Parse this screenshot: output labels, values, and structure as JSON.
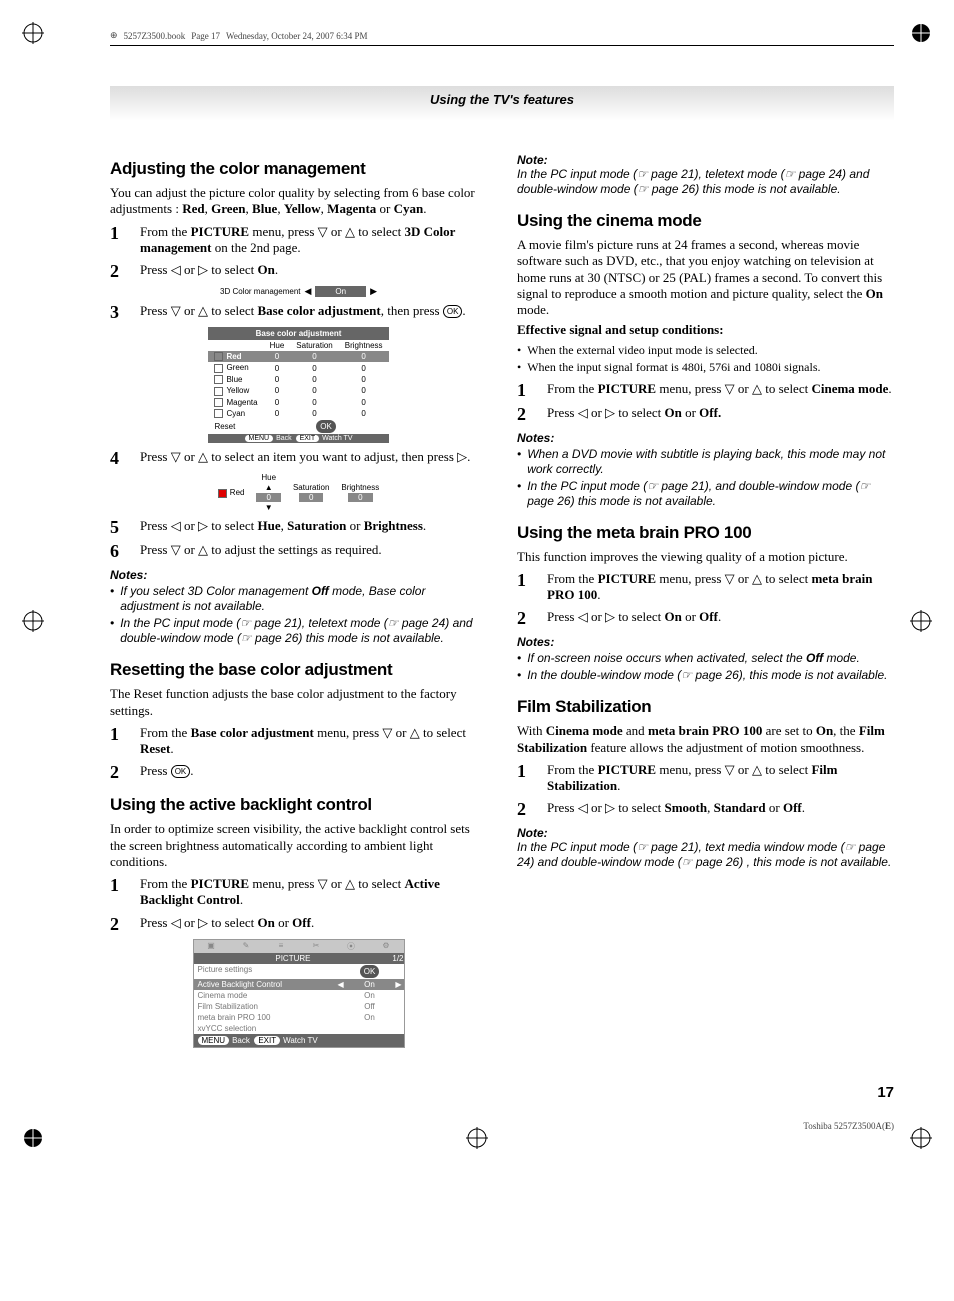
{
  "header": {
    "file": "5257Z3500.book",
    "page_info": "Page 17",
    "timestamp": "Wednesday, October 24, 2007  6:34 PM"
  },
  "banner": "Using the TV's features",
  "left": {
    "h1": "Adjusting the color management",
    "p1a": "You can adjust the picture color quality by selecting from 6 base color adjustments : ",
    "p1_red": "Red",
    "p1_c1": ", ",
    "p1_green": "Green",
    "p1_c2": ", ",
    "p1_blue": "Blue",
    "p1_c3": ", ",
    "p1_yellow": "Yellow",
    "p1_c4": ", ",
    "p1_magenta": "Magenta",
    "p1_or": " or ",
    "p1_cyan": "Cyan",
    "p1_end": ".",
    "s1a": "From the ",
    "s1b": "PICTURE",
    "s1c": " menu, press ▽ or △ to select ",
    "s1d": "3D Color management",
    "s1e": " on the 2nd page.",
    "s2a": "Press ◁ or ▷ to select ",
    "s2b": "On",
    "s2c": ".",
    "strip_label": "3D Color management",
    "strip_value": "On",
    "s3a": "Press ▽ or △ to select ",
    "s3b": "Base color adjustment",
    "s3c": ", then press ",
    "s3d": "OK",
    "s3e": ".",
    "osd_title": "Base color adjustment",
    "osd_cols": {
      "c1": "Hue",
      "c2": "Saturation",
      "c3": "Brightness"
    },
    "osd_rows": [
      {
        "name": "Red",
        "hue": "0",
        "sat": "0",
        "bri": "0",
        "sw": "#d00"
      },
      {
        "name": "Green",
        "hue": "0",
        "sat": "0",
        "bri": "0",
        "sw": "#0a0"
      },
      {
        "name": "Blue",
        "hue": "0",
        "sat": "0",
        "bri": "0",
        "sw": "#06c"
      },
      {
        "name": "Yellow",
        "hue": "0",
        "sat": "0",
        "bri": "0",
        "sw": "#dd0"
      },
      {
        "name": "Magenta",
        "hue": "0",
        "sat": "0",
        "bri": "0",
        "sw": "#c0c"
      },
      {
        "name": "Cyan",
        "hue": "0",
        "sat": "0",
        "bri": "0",
        "sw": "#0cc"
      }
    ],
    "osd_reset": "Reset",
    "osd_ok": "OK",
    "osd_ft_menu": "MENU",
    "osd_ft_back": "Back",
    "osd_ft_exit": "EXIT",
    "osd_ft_watch": "Watch TV",
    "s4": "Press ▽ or △ to select an item you want to adjust, then press ▷.",
    "hue_row": {
      "name": "Red",
      "hue_lbl": "Hue",
      "sat_lbl": "Saturation",
      "bri_lbl": "Brightness",
      "hue": "0",
      "sat": "0",
      "bri": "0"
    },
    "s5a": "Press ◁ or ▷ to select ",
    "s5b": "Hue",
    "s5c": ", ",
    "s5d": "Saturation",
    "s5e": " or ",
    "s5f": "Brightness",
    "s5g": ".",
    "s6": "Press ▽ or △ to adjust the settings as required.",
    "notes1_hdr": "Notes:",
    "n1a": "If you select 3D Color management ",
    "n1b": "Off",
    "n1c": " mode, Base color adjustment is not available.",
    "n2": "In the PC input mode (☞ page 21), teletext mode (☞ page 24) and double-window mode (☞ page 26) this mode is not available.",
    "h2": "Resetting the base color adjustment",
    "p2": "The Reset function adjusts the base color adjustment to the factory settings.",
    "r1a": "From the ",
    "r1b": "Base color adjustment",
    "r1c": " menu, press ▽ or △ to select ",
    "r1d": "Reset",
    "r1e": ".",
    "r2a": "Press ",
    "r2b": "OK",
    "r2c": ".",
    "h3": "Using the active backlight control",
    "p3": "In order to optimize screen visibility, the active backlight control sets the screen brightness automatically according to ambient light conditions.",
    "a1a": "From the ",
    "a1b": "PICTURE",
    "a1c": " menu, press ▽ or △ to select ",
    "a1d": "Active Backlight Control",
    "a1e": ".",
    "a2a": "Press ◁ or ▷ to select ",
    "a2b": "On",
    "a2c": " or ",
    "a2d": "Off",
    "a2e": ".",
    "menu": {
      "title": "PICTURE",
      "pg": "1/2",
      "rows": [
        {
          "k": "Picture settings",
          "v": "OK",
          "ok": true
        },
        {
          "k": "Active Backlight Control",
          "v": "On",
          "hl": true
        },
        {
          "k": "Cinema mode",
          "v": "On"
        },
        {
          "k": "Film Stabilization",
          "v": "Off"
        },
        {
          "k": "meta brain PRO 100",
          "v": "On"
        },
        {
          "k": "xvYCC selection",
          "v": ""
        }
      ],
      "ft_menu": "MENU",
      "ft_back": "Back",
      "ft_exit": "EXIT",
      "ft_watch": "Watch TV"
    }
  },
  "right": {
    "note_hdr": "Note:",
    "note1": "In the PC input mode (☞ page 21), teletext mode (☞ page 24) and double-window mode (☞ page 26) this mode is not available.",
    "h1": "Using the cinema mode",
    "p1a": "A movie film's picture runs at 24 frames a second, whereas movie software such as DVD, etc., that you enjoy watching on television at home runs at 30 (NTSC) or 25 (PAL) frames a second. To convert this signal to reproduce a smooth motion and picture quality, select the ",
    "p1b": "On",
    "p1c": " mode.",
    "eff_hdr": "Effective signal and setup conditions:",
    "eff1": "When the external video input mode is selected.",
    "eff2": "When the input signal format is 480i, 576i and 1080i signals.",
    "c1a": "From the ",
    "c1b": "PICTURE",
    "c1c": " menu, press ▽ or △ to select ",
    "c1d": "Cinema mode",
    "c1e": ".",
    "c2a": "Press ◁ or ▷ to select ",
    "c2b": "On",
    "c2c": " or ",
    "c2d": "Off.",
    "notes2_hdr": "Notes:",
    "cn1": "When a DVD movie with subtitle is playing back, this mode may not work correctly.",
    "cn2": "In the PC input mode (☞ page 21), and double-window mode (☞ page 26) this mode is not available.",
    "h2": "Using the meta brain PRO 100",
    "p2": "This function improves the viewing quality of a motion picture.",
    "m1a": "From the ",
    "m1b": "PICTURE",
    "m1c": " menu, press ▽ or △ to select ",
    "m1d": "meta brain PRO 100",
    "m1e": ".",
    "m2a": "Press ◁ or ▷ to select ",
    "m2b": "On",
    "m2c": " or ",
    "m2d": "Off",
    "m2e": ".",
    "notes3_hdr": "Notes:",
    "mn1a": "If on-screen noise occurs when activated, select the ",
    "mn1b": "Off",
    "mn1c": " mode.",
    "mn2": "In the double-window mode (☞ page 26), this mode is not available.",
    "h3": "Film Stabilization",
    "p3a": "With ",
    "p3b": "Cinema mode",
    "p3c": " and ",
    "p3d": "meta brain PRO 100",
    "p3e": " are set to ",
    "p3f": "On",
    "p3g": ", the ",
    "p3h": "Film Stabilization",
    "p3i": " feature allows the adjustment of motion smoothness.",
    "f1a": "From the ",
    "f1b": "PICTURE",
    "f1c": " menu, press ▽ or △ to select ",
    "f1d": "Film Stabilization",
    "f1e": ".",
    "f2a": "Press ◁ or ▷ to select ",
    "f2b": "Smooth",
    "f2c": ", ",
    "f2d": "Standard",
    "f2e": " or ",
    "f2f": "Off",
    "f2g": ".",
    "note4_hdr": "Note:",
    "note4": "In the PC input mode (☞ page 21), text media window mode (☞ page 24) and double-window mode (☞ page 26) , this mode is not available."
  },
  "page_num": "17",
  "footer_a": "Toshiba 5257Z3500A(",
  "footer_b": "E",
  "footer_c": ")"
}
